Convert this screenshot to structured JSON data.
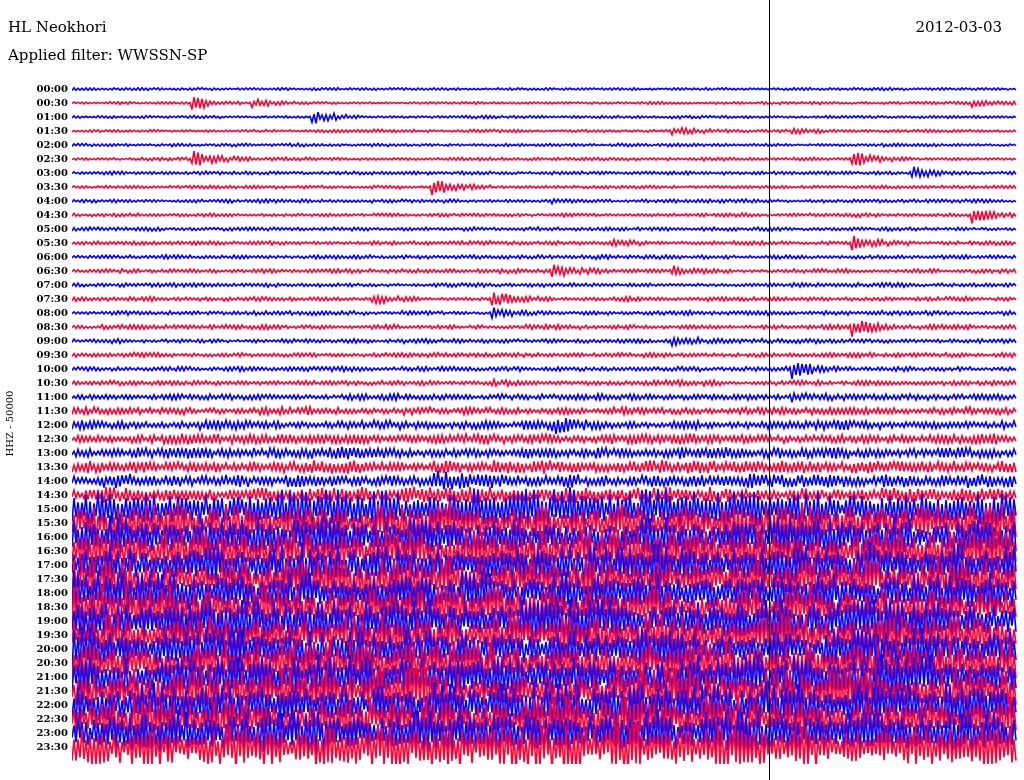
{
  "station": "HL Neokhori",
  "filter": "Applied filter: WWSSN-SP",
  "date": "2012-03-03",
  "channel_label": "HHZ - 50000",
  "rows": [
    {
      "time": "00:00",
      "color": "#0000ff"
    },
    {
      "time": "00:30",
      "color": "#ff0033"
    },
    {
      "time": "01:00",
      "color": "#0000ff"
    },
    {
      "time": "01:30",
      "color": "#ff0033"
    },
    {
      "time": "02:00",
      "color": "#0000ff"
    },
    {
      "time": "02:30",
      "color": "#ff0033"
    },
    {
      "time": "03:00",
      "color": "#0000ff"
    },
    {
      "time": "03:30",
      "color": "#ff0033"
    },
    {
      "time": "04:00",
      "color": "#0000ff"
    },
    {
      "time": "04:30",
      "color": "#ff0033"
    },
    {
      "time": "05:00",
      "color": "#0000ff"
    },
    {
      "time": "05:30",
      "color": "#ff0033"
    },
    {
      "time": "06:00",
      "color": "#0000ff"
    },
    {
      "time": "06:30",
      "color": "#ff0033"
    },
    {
      "time": "07:00",
      "color": "#0000ff"
    },
    {
      "time": "07:30",
      "color": "#ff0033"
    },
    {
      "time": "08:00",
      "color": "#0000ff"
    },
    {
      "time": "08:30",
      "color": "#ff0033"
    },
    {
      "time": "09:00",
      "color": "#0000ff"
    },
    {
      "time": "09:30",
      "color": "#ff0033"
    },
    {
      "time": "10:00",
      "color": "#0000ff"
    },
    {
      "time": "10:30",
      "color": "#ff0033"
    },
    {
      "time": "11:00",
      "color": "#0000ff"
    },
    {
      "time": "11:30",
      "color": "#ff0033"
    },
    {
      "time": "12:00",
      "color": "#0000ff"
    },
    {
      "time": "12:30",
      "color": "#ff0033"
    },
    {
      "time": "13:00",
      "color": "#0000ff"
    },
    {
      "time": "13:30",
      "color": "#ff0033"
    },
    {
      "time": "14:00",
      "color": "#0000ff"
    },
    {
      "time": "14:30",
      "color": "#ff0033"
    },
    {
      "time": "15:00",
      "color": "#0000ff"
    },
    {
      "time": "15:30",
      "color": "#ff0033"
    },
    {
      "time": "16:00",
      "color": "#0000ff"
    },
    {
      "time": "16:30",
      "color": "#ff0033"
    },
    {
      "time": "17:00",
      "color": "#0000ff"
    },
    {
      "time": "17:30",
      "color": "#ff0033"
    },
    {
      "time": "18:00",
      "color": "#0000ff"
    },
    {
      "time": "18:30",
      "color": "#ff0033"
    },
    {
      "time": "19:00",
      "color": "#0000ff"
    },
    {
      "time": "19:30",
      "color": "#ff0033"
    },
    {
      "time": "20:00",
      "color": "#0000ff"
    },
    {
      "time": "20:30",
      "color": "#ff0033"
    },
    {
      "time": "21:00",
      "color": "#0000ff"
    },
    {
      "time": "21:30",
      "color": "#ff0033"
    },
    {
      "time": "22:00",
      "color": "#0000ff"
    },
    {
      "time": "22:30",
      "color": "#ff0033"
    },
    {
      "time": "23:00",
      "color": "#0000ff"
    },
    {
      "time": "23:30",
      "color": "#ff0033"
    }
  ]
}
